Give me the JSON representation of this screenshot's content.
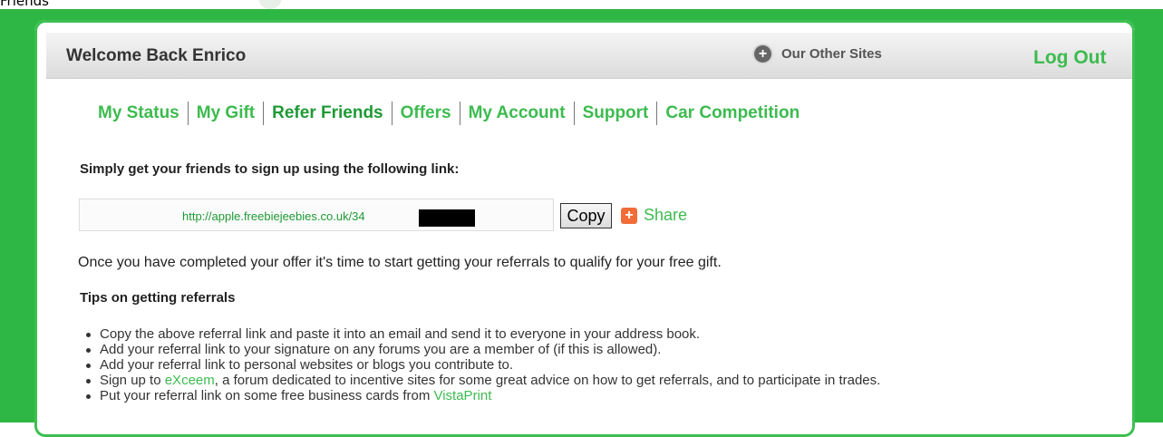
{
  "breadcrumb": "Friends",
  "header": {
    "welcome": "Welcome Back Enrico",
    "other_sites": "Our Other Sites",
    "logout": "Log Out"
  },
  "nav": {
    "items": [
      "My Status",
      "My Gift",
      "Refer Friends",
      "Offers",
      "My Account",
      "Support",
      "Car Competition"
    ],
    "active": "Refer Friends"
  },
  "refer": {
    "instruction": "Simply get your friends to sign up using the following link:",
    "link": "http://apple.freebiejeebies.co.uk/34",
    "copy_label": "Copy",
    "share_label": "Share"
  },
  "main": {
    "complete_text": "Once you have completed your offer it's time to start getting your referrals to qualify for your free gift.",
    "tips_title": "Tips on getting referrals",
    "tips": {
      "t1": "Copy the above referral link and paste it into an email and send it to everyone in your address book.",
      "t2": "Add your referral link to your signature on any forums you are a member of (if this is allowed).",
      "t3": "Add your referral link to personal websites or blogs you contribute to.",
      "t4_pre": "Sign up to ",
      "t4_link": "eXceem",
      "t4_post": ", a forum dedicated to incentive sites for some great advice on how to get referrals, and to participate in trades.",
      "t5_pre": "Put your referral link on some free business cards from ",
      "t5_link": "VistaPrint"
    }
  },
  "colors": {
    "frame_green": "#2fb745",
    "link_green": "#3dbb4f",
    "share_orange": "#f26c38"
  }
}
